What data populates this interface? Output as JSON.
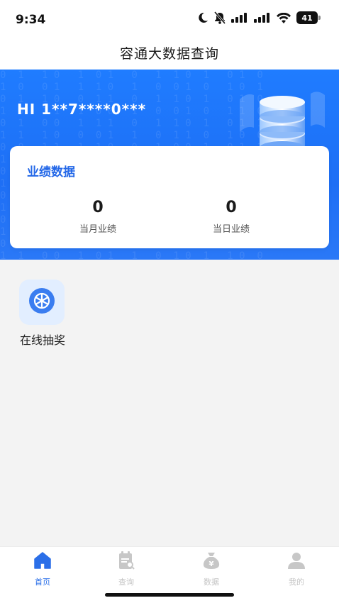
{
  "status_bar": {
    "time": "9:34",
    "battery": "41"
  },
  "nav": {
    "title": "容通大数据查询"
  },
  "hero": {
    "greeting": "HI 1**7****0***",
    "code_rain": "0  1   1 0   1  0 1   0   1  1 0  1   0 1  0\n1  0   0 1   1  1 0   1   0  0 1  0   1 0  1\n0  1   1 0   0  1 1   0   1  1 0  1   0 1  0\n1  0   1 1   1  0 0   1   0  0 1  0   1 1  0\n0  1   0 0   1  1 1   0   1  1 0  1   0 1  1\n1  1   1 0   0  0 1   1   0  1 1  0   1 0  0\n0  0   1 1   1  1 0   0   1  0 0  1   0 1  1\n1  1   0 0   1  0 1   1   0  1 1  0   1 0  0\n0  1   1 1   0  1 0   0   1  0 1  1   0 1  1\n1  0   0 1   1  0 1   1   0  1 0  0   1 1  0\n0  1   1 0   0  1 1   0   1  0 1  1   0 0  1\n1  0   1 1   1  0 0   1   0  1 0  1   1 1  0\n0  1   0 0   1  1 1   0   1  0 1  0   0 1  1\n1  1   1 0   0  0 1   1   0  1 0  1   1 0  0\n0  0   1 1   1  1 0   0   1  0 1  0   0 1  1\n1  1   0 0   1  0 1   1   0  1 0  1   1 0  0"
  },
  "performance": {
    "title": "业绩数据",
    "month_value": "0",
    "month_label": "当月业绩",
    "day_value": "0",
    "day_label": "当日业绩"
  },
  "menu": {
    "items": [
      {
        "label": "在线抽奖",
        "icon": "lottery-wheel-icon"
      }
    ]
  },
  "tabbar": {
    "tabs": [
      {
        "label": "首页",
        "icon": "home-icon",
        "active": true
      },
      {
        "label": "查询",
        "icon": "clipboard-query-icon",
        "active": false
      },
      {
        "label": "数据",
        "icon": "money-bag-icon",
        "active": false
      },
      {
        "label": "我的",
        "icon": "user-icon",
        "active": false
      }
    ]
  },
  "colors": {
    "brand_blue": "#1f7cff",
    "card_title": "#2468e8",
    "tab_active": "#2b6fe8",
    "tab_inactive": "#c4c4c4"
  }
}
